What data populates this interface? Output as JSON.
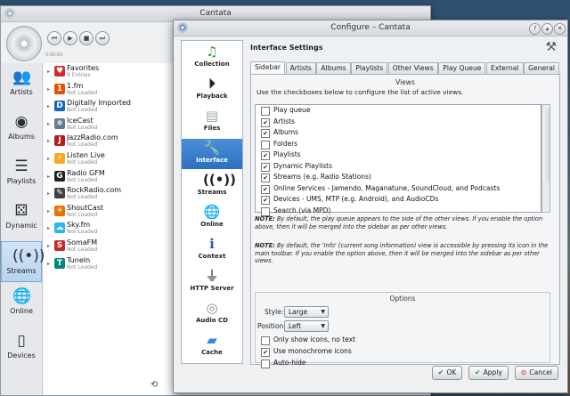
{
  "bg_window": {
    "title": "Cantata",
    "time_label": "0:00:00",
    "nav": [
      {
        "label": "Artists",
        "icon": "artist-icon"
      },
      {
        "label": "Albums",
        "icon": "album-icon"
      },
      {
        "label": "Playlists",
        "icon": "playlist-icon"
      },
      {
        "label": "Dynamic",
        "icon": "dice-icon"
      },
      {
        "label": "Streams",
        "icon": "streams-icon"
      },
      {
        "label": "Online",
        "icon": "globe-icon"
      },
      {
        "label": "Devices",
        "icon": "device-icon"
      }
    ],
    "streams": [
      {
        "name": "Favorites",
        "sub": "9 Entries",
        "icon": "heart-icon",
        "color": "#d32f2f"
      },
      {
        "name": "1.fm",
        "sub": "Not Loaded",
        "icon": "1fm-icon",
        "color": "#e65100"
      },
      {
        "name": "Digitally Imported",
        "sub": "Not Loaded",
        "icon": "di-icon",
        "color": "#1565c0"
      },
      {
        "name": "IceCast",
        "sub": "Not Loaded",
        "icon": "icecast-icon",
        "color": "#607d8b"
      },
      {
        "name": "JazzRadio.com",
        "sub": "Not Loaded",
        "icon": "jazzradio-icon",
        "color": "#b71c1c"
      },
      {
        "name": "Listen Live",
        "sub": "Not Loaded",
        "icon": "listenlive-icon",
        "color": "#f9a825"
      },
      {
        "name": "Radio GFM",
        "sub": "Not Loaded",
        "icon": "radiogfm-icon",
        "color": "#212121"
      },
      {
        "name": "RockRadio.com",
        "sub": "Not Loaded",
        "icon": "rockradio-icon",
        "color": "#424242"
      },
      {
        "name": "ShoutCast",
        "sub": "Not Loaded",
        "icon": "shoutcast-icon",
        "color": "#ef6c00"
      },
      {
        "name": "Sky.fm",
        "sub": "Not Loaded",
        "icon": "skyfm-icon",
        "color": "#29b6f6"
      },
      {
        "name": "SomaFM",
        "sub": "Not Loaded",
        "icon": "somafm-icon",
        "color": "#c62828"
      },
      {
        "name": "TuneIn",
        "sub": "Not Loaded",
        "icon": "tunein-icon",
        "color": "#00897b"
      }
    ]
  },
  "dialog": {
    "title": "Configure – Cantata",
    "header": "Interface Settings",
    "pages": [
      {
        "label": "Collection",
        "icon": "music-note-icon"
      },
      {
        "label": "Playback",
        "icon": "play-icon"
      },
      {
        "label": "Files",
        "icon": "files-icon"
      },
      {
        "label": "Interface",
        "icon": "interface-icon"
      },
      {
        "label": "Streams",
        "icon": "streams-icon"
      },
      {
        "label": "Online",
        "icon": "globe-icon"
      },
      {
        "label": "Context",
        "icon": "info-icon"
      },
      {
        "label": "HTTP Server",
        "icon": "http-server-icon"
      },
      {
        "label": "Audio CD",
        "icon": "cd-icon"
      },
      {
        "label": "Cache",
        "icon": "folder-icon"
      }
    ],
    "active_page": "Interface",
    "tabs": [
      "Sidebar",
      "Artists",
      "Albums",
      "Playlists",
      "Other Views",
      "Play Queue",
      "External",
      "General"
    ],
    "views_title": "Views",
    "views_desc": "Use the checkboxes below to configure the list of active views.",
    "views": [
      {
        "label": "Play queue",
        "checked": false
      },
      {
        "label": "Artists",
        "checked": true
      },
      {
        "label": "Albums",
        "checked": true
      },
      {
        "label": "Folders",
        "checked": false
      },
      {
        "label": "Playlists",
        "checked": true
      },
      {
        "label": "Dynamic Playlists",
        "checked": true
      },
      {
        "label": "Streams (e.g. Radio Stations)",
        "checked": true
      },
      {
        "label": "Online Services - Jamendo, Maganatune, SoundCloud, and Podcasts",
        "checked": true
      },
      {
        "label": "Devices - UMS, MTP (e.g. Android), and AudioCDs",
        "checked": true
      },
      {
        "label": "Search (via MPD)",
        "checked": false
      }
    ],
    "note1_bold": "NOTE:",
    "note1": "By default, the play queue appears to the side of the other views. If you enable the option above, then it will be merged into the sidebar as per other views.",
    "note2_bold": "NOTE:",
    "note2": "By default, the 'Info' (current song information) view is accessible by pressing its icon in the main toolbar. If you enable the option above, then it will be merged into the sidebar as per other views.",
    "options_title": "Options",
    "style_label": "Style:",
    "style_value": "Large",
    "position_label": "Position:",
    "position_value": "Left",
    "options": [
      {
        "label": "Only show icons, no text",
        "checked": false
      },
      {
        "label": "Use monochrome icons",
        "checked": true
      },
      {
        "label": "Auto-hide",
        "checked": false
      }
    ],
    "buttons": {
      "ok": "OK",
      "apply": "Apply",
      "cancel": "Cancel"
    }
  }
}
